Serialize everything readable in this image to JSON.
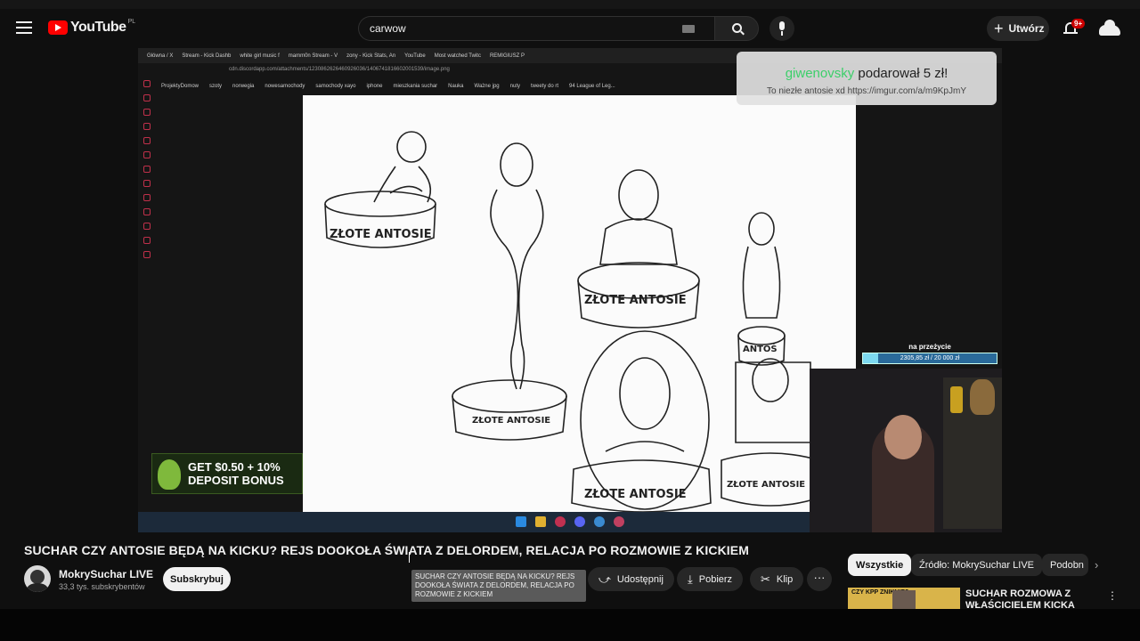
{
  "header": {
    "logo_text": "YouTube",
    "logo_country": "PL",
    "search_value": "carwow",
    "create_label": "Utwórz",
    "notifications_badge": "9+"
  },
  "video_frame": {
    "browser_tabs": [
      "Główna / X",
      "Stream - Kick Dashb",
      "white girl music f",
      "mamm0n Stream - V",
      "zony - Kick Stats, An",
      "YouTube",
      "Most watched Twitc",
      "REMIGIUSZ P"
    ],
    "url": "cdn.discordapp.com/attachments/1230862626460926036/1406741816602001539/image.png",
    "bookmarks": [
      "ProjektyDomow",
      "szoty",
      "norwegia",
      "nowesamochody",
      "samochody xayo",
      "iphone",
      "mieszkania suchar",
      "Nauka",
      "Ważne jpg",
      "nuty",
      "tweety do rt",
      "94 League of Leg..."
    ],
    "donation": {
      "donor": "giwenovsky",
      "verb": "podarował",
      "amount": "5 zł!",
      "message": "To niezłe antosie xd https://imgur.com/a/m9KpJmY"
    },
    "sketch_labels": [
      "ZŁOTE ANTOSIE",
      "ZŁOTE ANTOSIE",
      "ZŁOTE ANTOSIE",
      "ANTOŚ",
      "ZŁOTE ANTOSIE",
      "ZŁOTE ANTOSIE"
    ],
    "promo": {
      "line1": "GET $0.50 + 10%",
      "line2": "DEPOSIT BONUS"
    },
    "goal": {
      "label": "na przeżycie",
      "text": "2305,85 zł / 20 000 zł",
      "progress": 0.115
    }
  },
  "video_title": "SUCHAR CZY ANTOSIE BĘDĄ NA KICKU? REJS DOOKOŁA ŚWIATA Z DELORDEM, RELACJA PO ROZMOWIE Z KICKIEM",
  "channel": {
    "name": "MokrySuchar LIVE",
    "subscribers": "33,3 tys. subskrybentów",
    "subscribe_label": "Subskrybuj"
  },
  "tooltip_text": "SUCHAR CZY ANTOSIE BĘDĄ NA KICKU? REJS DOOKOŁA ŚWIATA Z DELORDEM, RELACJA PO ROZMOWIE Z KICKIEM",
  "actions": {
    "share_label": "Udostępnij",
    "download_label": "Pobierz",
    "clip_label": "Klip",
    "more_label": "···"
  },
  "chips": [
    "Wszystkie",
    "Źródło: MokrySuchar LIVE",
    "Podobn"
  ],
  "recommendation": {
    "thumb_text": "CZY KPP ZNIKNIE?",
    "title": "SUCHAR ROZMOWA Z WŁAŚCICIELEM KICKA (KICK"
  }
}
